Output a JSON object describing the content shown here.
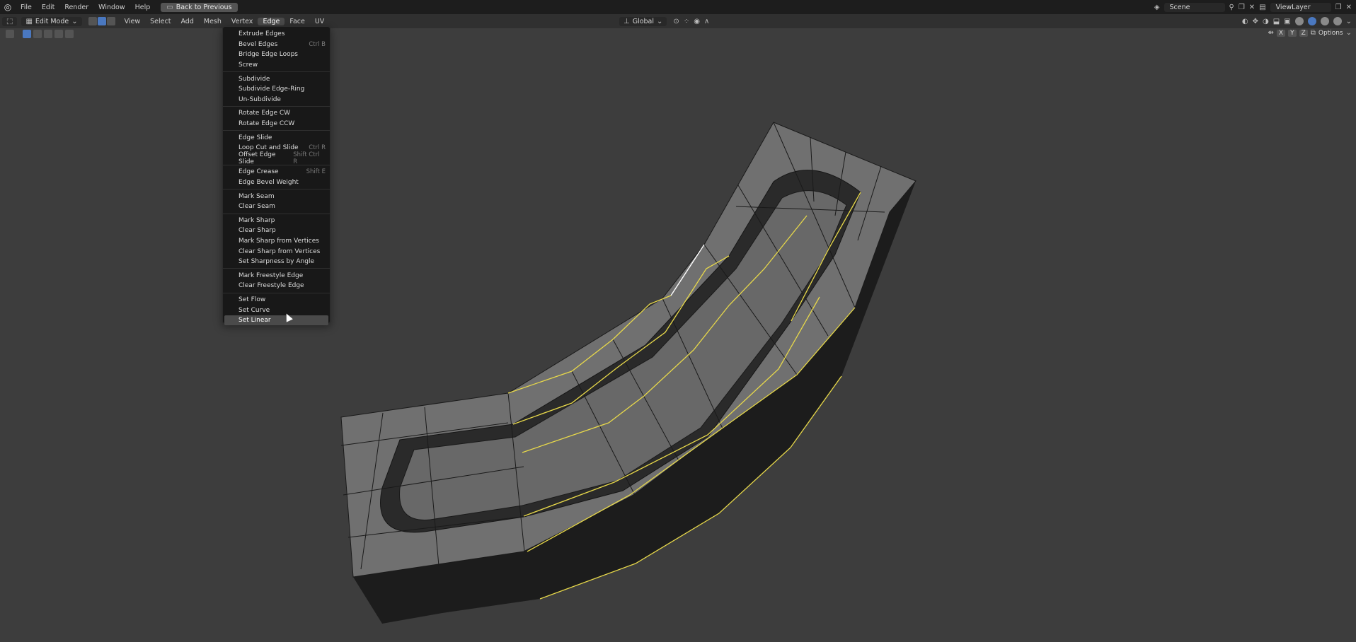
{
  "topbar": {
    "logo_icon": "blender-logo-icon",
    "menus": [
      "File",
      "Edit",
      "Render",
      "Window",
      "Help"
    ],
    "back_button": "Back to Previous",
    "scene": "Scene",
    "view_layer": "ViewLayer"
  },
  "header": {
    "mode": "Edit Mode",
    "menus": [
      "View",
      "Select",
      "Add",
      "Mesh",
      "Vertex",
      "Edge",
      "Face",
      "UV"
    ],
    "active_menu": "Edge",
    "orientation": "Global",
    "options": "Options",
    "axes": [
      "X",
      "Y",
      "Z"
    ]
  },
  "edge_menu": {
    "groups": [
      [
        {
          "label": "Extrude Edges",
          "shortcut": ""
        },
        {
          "label": "Bevel Edges",
          "shortcut": "Ctrl B"
        },
        {
          "label": "Bridge Edge Loops",
          "shortcut": ""
        },
        {
          "label": "Screw",
          "shortcut": ""
        }
      ],
      [
        {
          "label": "Subdivide",
          "shortcut": ""
        },
        {
          "label": "Subdivide Edge-Ring",
          "shortcut": ""
        },
        {
          "label": "Un-Subdivide",
          "shortcut": ""
        }
      ],
      [
        {
          "label": "Rotate Edge CW",
          "shortcut": ""
        },
        {
          "label": "Rotate Edge CCW",
          "shortcut": ""
        }
      ],
      [
        {
          "label": "Edge Slide",
          "shortcut": ""
        },
        {
          "label": "Loop Cut and Slide",
          "shortcut": "Ctrl R"
        },
        {
          "label": "Offset Edge Slide",
          "shortcut": "Shift Ctrl R"
        }
      ],
      [
        {
          "label": "Edge Crease",
          "shortcut": "Shift E"
        },
        {
          "label": "Edge Bevel Weight",
          "shortcut": ""
        }
      ],
      [
        {
          "label": "Mark Seam",
          "shortcut": ""
        },
        {
          "label": "Clear Seam",
          "shortcut": ""
        }
      ],
      [
        {
          "label": "Mark Sharp",
          "shortcut": ""
        },
        {
          "label": "Clear Sharp",
          "shortcut": ""
        },
        {
          "label": "Mark Sharp from Vertices",
          "shortcut": ""
        },
        {
          "label": "Clear Sharp from Vertices",
          "shortcut": ""
        },
        {
          "label": "Set Sharpness by Angle",
          "shortcut": ""
        }
      ],
      [
        {
          "label": "Mark Freestyle Edge",
          "shortcut": ""
        },
        {
          "label": "Clear Freestyle Edge",
          "shortcut": ""
        }
      ],
      [
        {
          "label": "Set Flow",
          "shortcut": ""
        },
        {
          "label": "Set Curve",
          "shortcut": ""
        },
        {
          "label": "Set Linear",
          "shortcut": "",
          "highlighted": true
        }
      ]
    ]
  },
  "colors": {
    "selected_edge": "#e8d94a",
    "active_edge": "#ffffff",
    "mesh_face": "#6e6e6e",
    "viewport_bg": "#3d3d3d"
  }
}
